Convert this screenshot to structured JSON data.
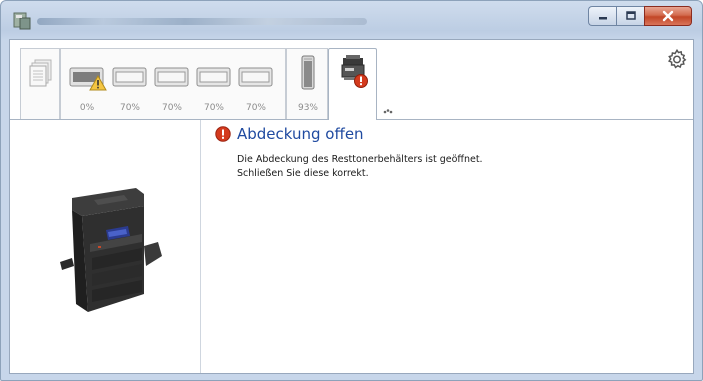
{
  "window": {
    "icon": "printer-app-icon",
    "title_obscured": true
  },
  "caption": {
    "minimize": "minimize-icon",
    "maximize": "maximize-icon",
    "close": "close-icon"
  },
  "toolbar": {
    "document_icon": "document-stack-icon",
    "toner": [
      {
        "percent": "0%",
        "warning": true
      },
      {
        "percent": "70%",
        "warning": false
      },
      {
        "percent": "70%",
        "warning": false
      },
      {
        "percent": "70%",
        "warning": false
      },
      {
        "percent": "70%",
        "warning": false
      }
    ],
    "waste_toner": {
      "percent": "93%"
    },
    "active_tab_icon": "printer-error-icon",
    "settings_icon": "gear-icon"
  },
  "status": {
    "title": "Abdeckung offen",
    "line1": "Die Abdeckung des Resttonerbehälters ist geöffnet.",
    "line2": "Schließen Sie diese korrekt.",
    "severity_color": "#d43a1d",
    "title_color": "#1f4aa0"
  }
}
